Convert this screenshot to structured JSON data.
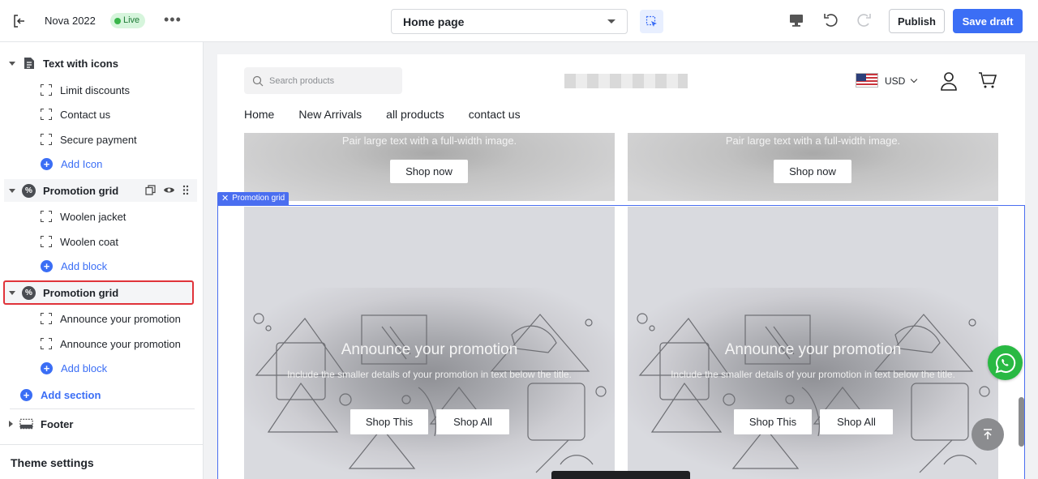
{
  "topbar": {
    "store_name": "Nova 2022",
    "status_badge": "Live",
    "page_select": "Home page",
    "publish_label": "Publish",
    "save_label": "Save draft",
    "icons": [
      "exit-icon",
      "more-icon",
      "inspect-icon",
      "desktop-icon",
      "undo-icon",
      "redo-icon"
    ]
  },
  "sidebar": {
    "sections": [
      {
        "label": "Text with icons",
        "icon": "document-icon",
        "blocks": [
          "Limit discounts",
          "Contact us",
          "Secure payment"
        ],
        "add_label": "Add Icon"
      },
      {
        "label": "Promotion grid",
        "icon": "percent-icon",
        "blocks": [
          "Woolen jacket",
          "Woolen coat"
        ],
        "add_label": "Add block"
      },
      {
        "label": "Promotion grid",
        "icon": "percent-icon",
        "selected": true,
        "blocks": [
          "Announce your promotion",
          "Announce your promotion"
        ],
        "add_label": "Add block"
      }
    ],
    "add_section_label": "Add section",
    "footer_label": "Footer",
    "theme_settings_label": "Theme settings"
  },
  "canvas": {
    "search_placeholder": "Search products",
    "currency": "USD",
    "nav": [
      "Home",
      "New Arrivals",
      "all products",
      "contact us"
    ],
    "banners": [
      {
        "text": "Pair large text with a full-width image.",
        "button": "Shop now"
      },
      {
        "text": "Pair large text with a full-width image.",
        "button": "Shop now"
      }
    ],
    "section_tag": "Promotion grid",
    "promos": [
      {
        "title": "Announce your promotion",
        "description": "Include the smaller details of your promotion in text below the title.",
        "button1": "Shop This",
        "button2": "Shop All"
      },
      {
        "title": "Announce your promotion",
        "description": "Include the smaller details of your promotion in text below the title.",
        "button1": "Shop This",
        "button2": "Shop All"
      }
    ]
  },
  "colors": {
    "accent": "#3b6ef5",
    "live_bg": "#d6f5dc",
    "selection_outline": "#e0333a",
    "section_outline": "#4a6ef0",
    "whatsapp": "#29b943"
  }
}
